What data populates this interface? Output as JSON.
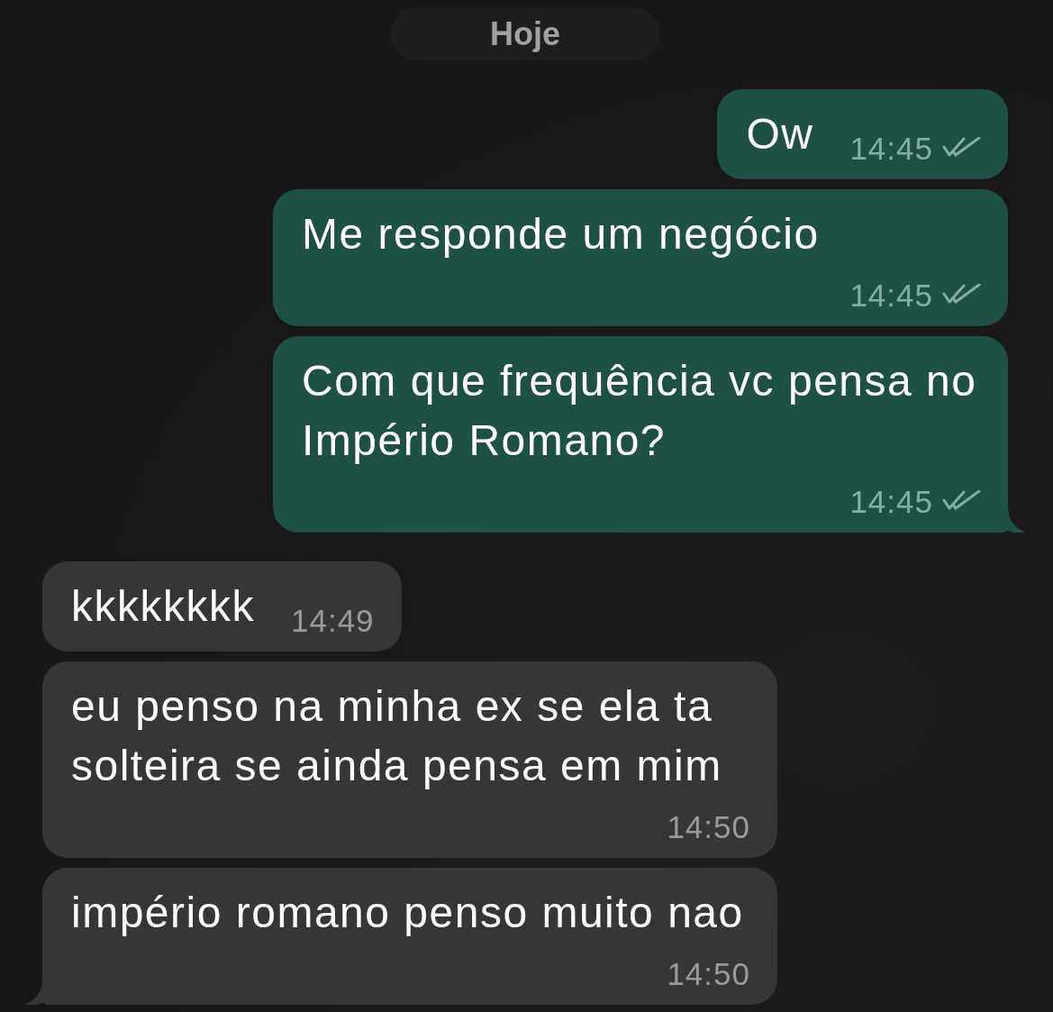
{
  "date_separator": {
    "label": "Hoje"
  },
  "messages": [
    {
      "kind": "outgoing",
      "text": "Ow",
      "time": "14:45",
      "delivered": true,
      "tail": false
    },
    {
      "kind": "outgoing",
      "text": "Me responde um negócio",
      "time": "14:45",
      "delivered": true,
      "tail": false
    },
    {
      "kind": "outgoing",
      "text": "Com que frequência vc pensa no Império Romano?",
      "time": "14:45",
      "delivered": true,
      "tail": true
    },
    {
      "kind": "incoming",
      "text": "kkkkkkkk",
      "time": "14:49",
      "tail": false
    },
    {
      "kind": "incoming",
      "text": "eu penso na minha ex se ela ta solteira se ainda pensa em mim",
      "time": "14:50",
      "tail": false
    },
    {
      "kind": "incoming",
      "text": "império romano penso muito nao",
      "time": "14:50",
      "tail": true
    }
  ]
}
